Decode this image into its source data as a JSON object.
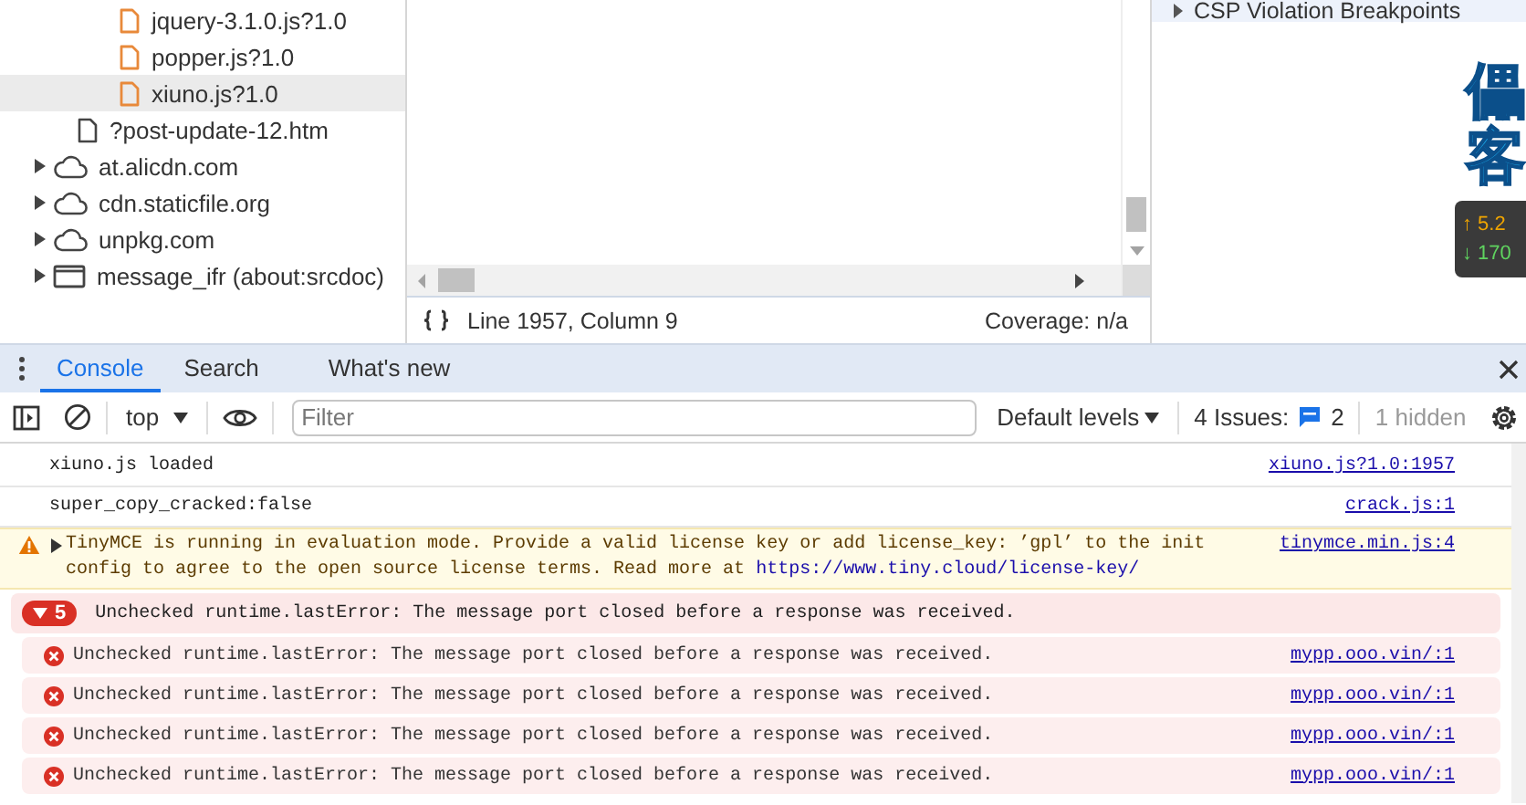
{
  "tree": [
    {
      "kind": "script",
      "label": "jquery-3.1.0.js?1.0",
      "selected": false
    },
    {
      "kind": "script",
      "label": "popper.js?1.0",
      "selected": false
    },
    {
      "kind": "script",
      "label": "xiuno.js?1.0",
      "selected": true
    },
    {
      "kind": "document",
      "label": "?post-update-12.htm",
      "selected": false
    },
    {
      "kind": "domain",
      "label": "at.alicdn.com",
      "selected": false,
      "expanded": false
    },
    {
      "kind": "domain",
      "label": "cdn.staticfile.org",
      "selected": false,
      "expanded": false
    },
    {
      "kind": "domain",
      "label": "unpkg.com",
      "selected": false,
      "expanded": false
    },
    {
      "kind": "frame",
      "label": "message_ifr (about:srcdoc)",
      "selected": false,
      "expanded": false
    }
  ],
  "editor": {
    "position": "Line 1957, Column 9",
    "coverage": "Coverage: n/a"
  },
  "sidebar_pane": {
    "section": "CSP Violation Breakpoints",
    "expanded": false
  },
  "overlay": {
    "characters": "儡客",
    "upload": "↑ 5.2",
    "download": "↓ 170"
  },
  "drawer": {
    "tabs": [
      {
        "label": "Console",
        "selected": true
      },
      {
        "label": "Search",
        "selected": false
      },
      {
        "label": "What's new",
        "selected": false
      }
    ]
  },
  "toolbar": {
    "context": "top",
    "filter_placeholder": "Filter",
    "levels": "Default levels",
    "issues_label": "4 Issues:",
    "issues_count": "2",
    "hidden": "1 hidden"
  },
  "messages": [
    {
      "kind": "log",
      "text": "xiuno.js loaded",
      "source": "xiuno.js?1.0:1957"
    },
    {
      "kind": "log",
      "text": "super_copy_cracked:false",
      "source": "crack.js:1"
    },
    {
      "kind": "warning",
      "expanded": false,
      "text": "TinyMCE is running in evaluation mode. Provide a valid license key or add license_key: ’gpl’ to the init config to agree to the open source license terms. Read more at ",
      "link": "https://www.tiny.cloud/license-key/",
      "source": "tinymce.min.js:4"
    },
    {
      "kind": "error-group",
      "expanded": true,
      "count": "5",
      "text": "Unchecked runtime.lastError: The message port closed before a response was received."
    },
    {
      "kind": "error",
      "text": "Unchecked runtime.lastError: The message port closed before a response was received.",
      "source": "mypp.ooo.vin/:1"
    },
    {
      "kind": "error",
      "text": "Unchecked runtime.lastError: The message port closed before a response was received.",
      "source": "mypp.ooo.vin/:1"
    },
    {
      "kind": "error",
      "text": "Unchecked runtime.lastError: The message port closed before a response was received.",
      "source": "mypp.ooo.vin/:1"
    },
    {
      "kind": "error",
      "text": "Unchecked runtime.lastError: The message port closed before a response was received.",
      "source": "mypp.ooo.vin/:1"
    }
  ]
}
